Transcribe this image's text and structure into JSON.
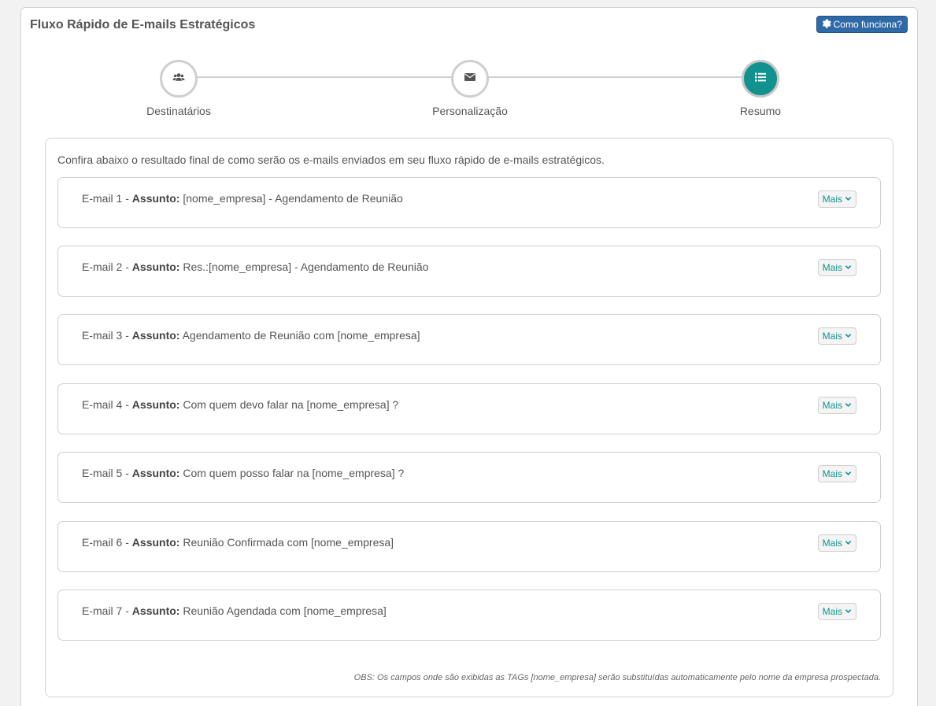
{
  "panel": {
    "title": "Fluxo Rápido de E-mails Estratégicos",
    "help_label": "Como funciona?"
  },
  "wizard": {
    "steps": [
      {
        "label": "Destinatários",
        "icon": "users-icon",
        "active": false
      },
      {
        "label": "Personalização",
        "icon": "envelope-icon",
        "active": false
      },
      {
        "label": "Resumo",
        "icon": "list-icon",
        "active": true
      }
    ]
  },
  "summary": {
    "intro": "Confira abaixo o resultado final de como serão os e-mails enviados em seu fluxo rápido de e-mails estratégicos.",
    "subject_label": "Assunto:",
    "more_label": "Mais",
    "emails": [
      {
        "number": "E-mail 1 - ",
        "subject": "[nome_empresa] - Agendamento de Reunião"
      },
      {
        "number": "E-mail 2 - ",
        "subject": "Res.:[nome_empresa] - Agendamento de Reunião"
      },
      {
        "number": "E-mail 3 - ",
        "subject": "Agendamento de Reunião com [nome_empresa]"
      },
      {
        "number": "E-mail 4 - ",
        "subject": "Com quem devo falar na [nome_empresa] ?"
      },
      {
        "number": "E-mail 5 - ",
        "subject": "Com quem posso falar na [nome_empresa] ?"
      },
      {
        "number": "E-mail 6 - ",
        "subject": "Reunião Confirmada com [nome_empresa]"
      },
      {
        "number": "E-mail 7 - ",
        "subject": "Reunião Agendada com [nome_empresa]"
      }
    ],
    "obs": "OBS: Os campos onde são exibidas as TAGs [nome_empresa] serão substituídas automaticamente pelo nome da empresa prospectada."
  },
  "colors": {
    "accent": "#11928f",
    "help_button": "#2f6aa8"
  }
}
